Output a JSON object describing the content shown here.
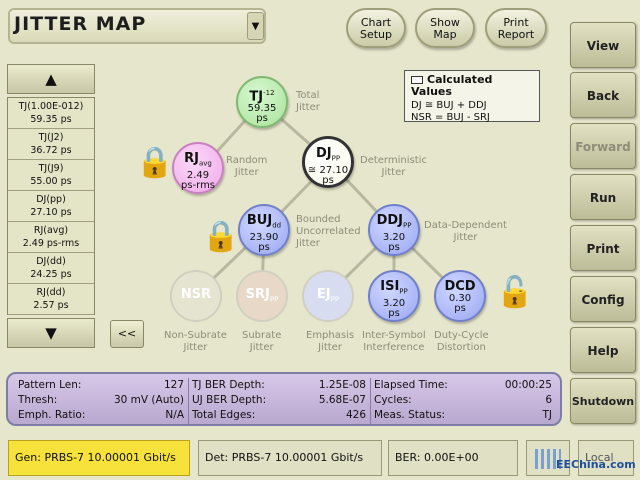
{
  "header": {
    "title": "JITTER MAP",
    "dropdown_icon": "triangle-down",
    "chart_setup": [
      "Chart",
      "Setup"
    ],
    "show_map": [
      "Show",
      "Map"
    ],
    "print_report": [
      "Print",
      "Report"
    ]
  },
  "side_menu": {
    "view": "View",
    "back": "Back",
    "forward": "Forward",
    "run": "Run",
    "print": "Print",
    "config": "Config",
    "help": "Help",
    "shutdown": "Shutdown"
  },
  "list": {
    "up_arrow": "▲",
    "down_arrow": "▼",
    "collapse": "<<",
    "items": [
      {
        "label": "TJ(1.00E-012)",
        "value": "59.35 ps"
      },
      {
        "label": "TJ(J2)",
        "value": "36.72 ps"
      },
      {
        "label": "TJ(J9)",
        "value": "55.00 ps"
      },
      {
        "label": "DJ(pp)",
        "value": "27.10 ps"
      },
      {
        "label": "RJ(avg)",
        "value": "2.49 ps-rms"
      },
      {
        "label": "DJ(dd)",
        "value": "24.25 ps"
      },
      {
        "label": "RJ(dd)",
        "value": "2.57 ps"
      }
    ]
  },
  "map": {
    "tj": {
      "name": "TJ",
      "sup": "-12",
      "value": "59.35",
      "unit": "ps",
      "desc": [
        "Total",
        "Jitter"
      ]
    },
    "rj": {
      "name": "RJ",
      "sub": "avg",
      "value": "2.49",
      "unit": "ps-rms",
      "desc": [
        "Random",
        "Jitter"
      ]
    },
    "dj": {
      "name": "DJ",
      "sub": "PP",
      "value": "≅ 27.10",
      "unit": "ps",
      "desc": [
        "Deterministic",
        "Jitter"
      ]
    },
    "buj": {
      "name": "BUJ",
      "sub": "dd",
      "value": "23.90",
      "unit": "ps",
      "desc": [
        "Bounded",
        "Uncorrelated",
        "Jitter"
      ]
    },
    "ddj": {
      "name": "DDJ",
      "sub": "PP",
      "value": "3.20",
      "unit": "ps",
      "desc": [
        "Data-Dependent",
        "Jitter"
      ]
    },
    "nsr": {
      "name": "NSR",
      "desc": [
        "Non-Subrate",
        "Jitter"
      ]
    },
    "srj": {
      "name": "SRJ",
      "sub": "PP",
      "desc": [
        "Subrate",
        "Jitter"
      ]
    },
    "ej": {
      "name": "EJ",
      "sub": "PP",
      "desc": [
        "Emphasis",
        "Jitter"
      ]
    },
    "isi": {
      "name": "ISI",
      "sub": "PP",
      "value": "3.20",
      "unit": "ps",
      "desc": [
        "Inter-Symbol",
        "Interference"
      ]
    },
    "dcd": {
      "name": "DCD",
      "value": "0.30",
      "unit": "ps",
      "desc": [
        "Duty-Cycle",
        "Distortion"
      ]
    }
  },
  "legend": {
    "title": "Calculated Values",
    "line1": "DJ ≅ BUJ + DDJ",
    "line2": "NSR = BUJ - SRJ"
  },
  "status": {
    "pattern_len": {
      "label": "Pattern Len:",
      "value": "127"
    },
    "thresh": {
      "label": "Thresh:",
      "value": "30 mV (Auto)"
    },
    "emph_ratio": {
      "label": "Emph. Ratio:",
      "value": "N/A"
    },
    "tj_ber": {
      "label": "TJ BER Depth:",
      "value": "1.25E-08"
    },
    "uj_ber": {
      "label": "UJ BER Depth:",
      "value": "5.68E-07"
    },
    "total_edges": {
      "label": "Total Edges:",
      "value": "426"
    },
    "elapsed": {
      "label": "Elapsed Time:",
      "value": "00:00:25"
    },
    "cycles": {
      "label": "Cycles:",
      "value": "6"
    },
    "meas_status": {
      "label": "Meas. Status:",
      "value": "TJ"
    }
  },
  "bottom": {
    "gen": "Gen: PRBS-7 10.00001 Gbit/s",
    "det": "Det: PRBS-7 10.00001 Gbit/s",
    "ber": "BER: 0.00E+00",
    "local": "Local",
    "watermark": "EEChina.com"
  },
  "colors": {
    "tj": "#a8e29a",
    "rj": "#f0a8e8",
    "dj": "#fffff0",
    "blue": "#9aa6f4",
    "gen_bg": "#f6e23a",
    "panel": "#c8b8df"
  }
}
